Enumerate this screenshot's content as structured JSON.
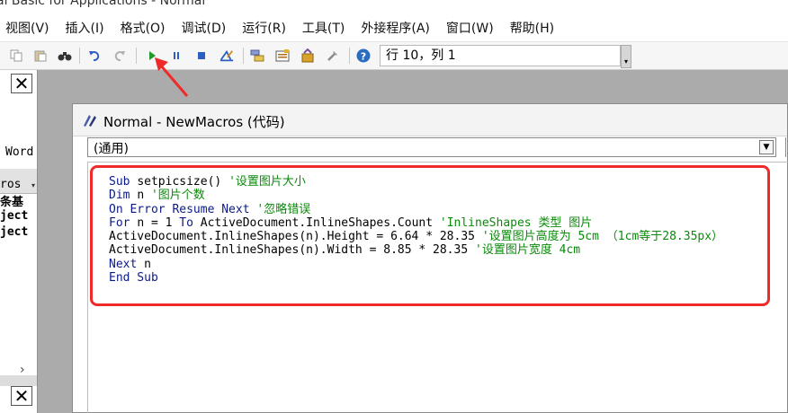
{
  "window": {
    "title": "al Basic for Applications - Normal"
  },
  "menu": [
    "视图(V)",
    "插入(I)",
    "格式(O)",
    "调试(D)",
    "运行(R)",
    "工具(T)",
    "外接程序(A)",
    "窗口(W)",
    "帮助(H)"
  ],
  "toolbar": {
    "icons": [
      "copy-icon",
      "paste-icon",
      "find-icon",
      "undo-icon",
      "redo-icon",
      "run-icon",
      "break-icon",
      "reset-icon",
      "design-mode-icon",
      "project-explorer-icon",
      "properties-icon",
      "object-browser-icon",
      "toolbox-icon",
      "help-icon"
    ],
    "position": "行 10，列 1"
  },
  "left_panel": {
    "close_glyph": "✕",
    "fragments": [
      "Word",
      "ros",
      "条基",
      "ject",
      "ject"
    ],
    "scroll_glyph": "›"
  },
  "code_window": {
    "title": "Normal - NewMacros (代码)",
    "object_combo": "(通用)",
    "code": [
      [
        {
          "t": "kw",
          "v": "Sub "
        },
        {
          "t": "tx",
          "v": "setpicsize() "
        },
        {
          "t": "cm",
          "v": "'设置图片大小"
        }
      ],
      [
        {
          "t": "kw",
          "v": "Dim "
        },
        {
          "t": "tx",
          "v": "n "
        },
        {
          "t": "cm",
          "v": "'图片个数"
        }
      ],
      [
        {
          "t": "kw",
          "v": "On Error Resume Next "
        },
        {
          "t": "cm",
          "v": "'忽略错误"
        }
      ],
      [
        {
          "t": "kw",
          "v": "For "
        },
        {
          "t": "tx",
          "v": "n = 1 "
        },
        {
          "t": "kw",
          "v": "To "
        },
        {
          "t": "tx",
          "v": "ActiveDocument.InlineShapes.Count "
        },
        {
          "t": "cm",
          "v": "'InlineShapes 类型 图片"
        }
      ],
      [
        {
          "t": "tx",
          "v": "ActiveDocument.InlineShapes(n).Height = 6.64 * 28.35 "
        },
        {
          "t": "cm",
          "v": "'设置图片高度为 5cm （1cm等于28.35px）"
        }
      ],
      [
        {
          "t": "tx",
          "v": "ActiveDocument.InlineShapes(n).Width = 8.85 * 28.35 "
        },
        {
          "t": "cm",
          "v": "'设置图片宽度 4cm"
        }
      ],
      [
        {
          "t": "kw",
          "v": "Next "
        },
        {
          "t": "tx",
          "v": "n"
        }
      ],
      [
        {
          "t": "kw",
          "v": "End Sub"
        }
      ]
    ]
  },
  "colors": {
    "keyword": "#0b1a88",
    "comment": "#0a8a0a",
    "highlight": "#ee2a2a"
  }
}
